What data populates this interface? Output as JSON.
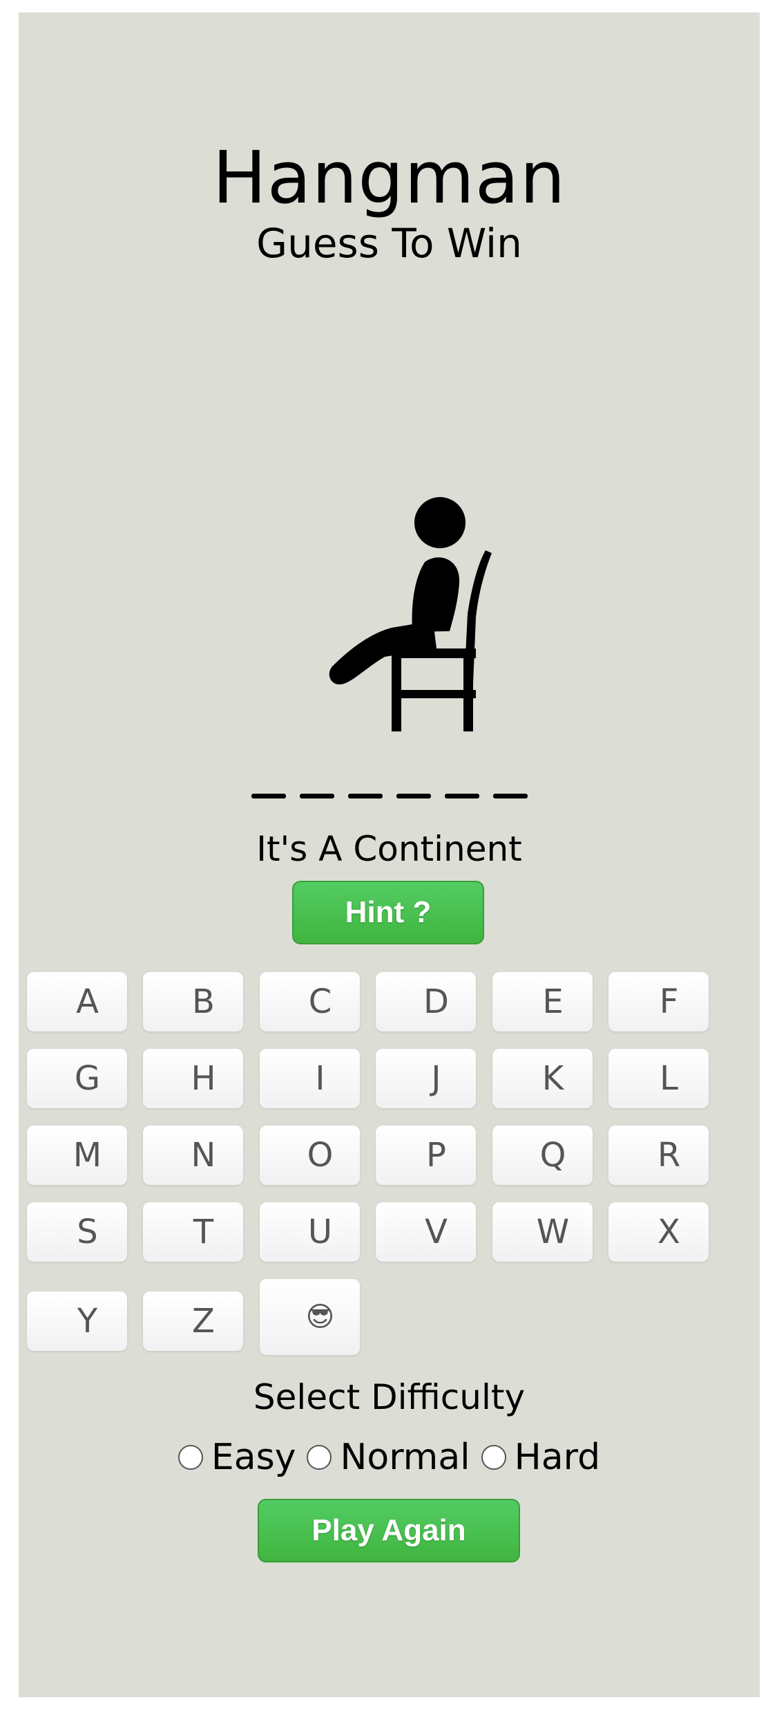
{
  "header": {
    "title": "Hangman",
    "subtitle": "Guess To Win"
  },
  "word": {
    "blank_count": 6
  },
  "clue": "It's A Continent",
  "hint_button": "Hint ?",
  "keyboard": {
    "keys": [
      "A",
      "B",
      "C",
      "D",
      "E",
      "F",
      "G",
      "H",
      "I",
      "J",
      "K",
      "L",
      "M",
      "N",
      "O",
      "P",
      "Q",
      "R",
      "S",
      "T",
      "U",
      "V",
      "W",
      "X",
      "Y",
      "Z",
      "😎"
    ]
  },
  "difficulty": {
    "label": "Select Difficulty",
    "options": [
      "Easy",
      "Normal",
      "Hard"
    ]
  },
  "play_again_button": "Play Again",
  "colors": {
    "panel": "#dcded5",
    "accent_green": "#4abf4c"
  }
}
